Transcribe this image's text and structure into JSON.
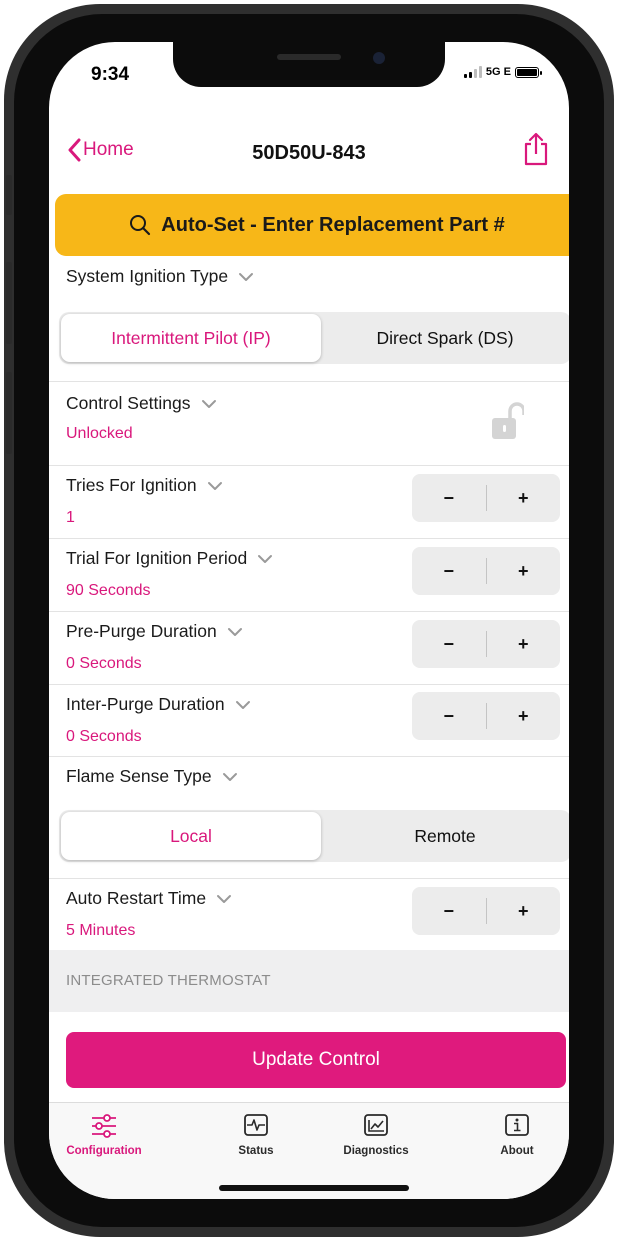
{
  "status_bar": {
    "time": "9:34",
    "network": "5G E"
  },
  "nav": {
    "back_label": "Home",
    "title": "50D50U-843"
  },
  "autoset": {
    "label": "Auto-Set - Enter Replacement Part #"
  },
  "ignition_type": {
    "label": "System Ignition Type",
    "options": [
      "Intermittent Pilot (IP)",
      "Direct Spark (DS)"
    ],
    "selected": "Intermittent Pilot (IP)"
  },
  "control_settings": {
    "label": "Control Settings",
    "value": "Unlocked",
    "lock_state": "unlocked"
  },
  "settings": [
    {
      "label": "Tries For Ignition",
      "value": "1"
    },
    {
      "label": "Trial For Ignition Period",
      "value": "90 Seconds"
    },
    {
      "label": "Pre-Purge Duration",
      "value": "0 Seconds"
    },
    {
      "label": "Inter-Purge Duration",
      "value": "0 Seconds"
    }
  ],
  "stepper": {
    "minus": "−",
    "plus": "+"
  },
  "flame_sense": {
    "label": "Flame Sense Type",
    "options": [
      "Local",
      "Remote"
    ],
    "selected": "Local"
  },
  "auto_restart": {
    "label": "Auto Restart Time",
    "value": "5 Minutes"
  },
  "section_header": "INTEGRATED THERMOSTAT",
  "update_button": "Update Control",
  "tabs": [
    {
      "label": "Configuration",
      "icon": "sliders-icon",
      "active": true
    },
    {
      "label": "Status",
      "icon": "pulse-icon",
      "active": false
    },
    {
      "label": "Diagnostics",
      "icon": "chart-icon",
      "active": false
    },
    {
      "label": "About",
      "icon": "info-icon",
      "active": false
    }
  ],
  "colors": {
    "accent": "#d9187c",
    "autoset_bg": "#f7b718",
    "button_bg": "#df1a7d"
  }
}
